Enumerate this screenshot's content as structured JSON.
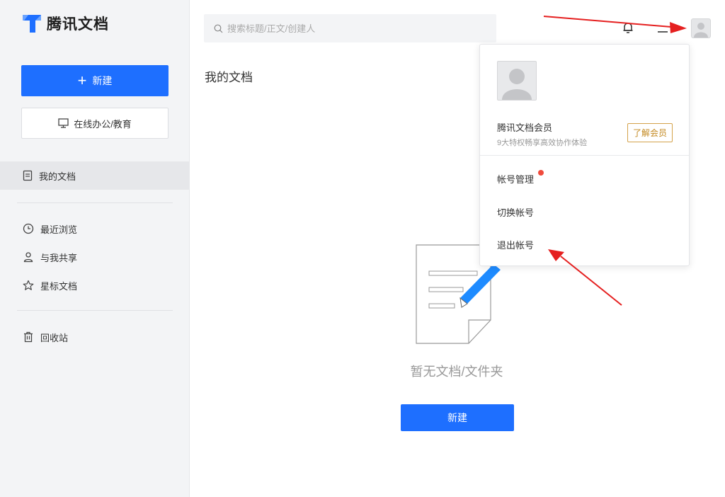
{
  "app": {
    "logo_text": "腾讯文档"
  },
  "sidebar": {
    "new_button": "新建",
    "office_button": "在线办公/教育",
    "items": [
      {
        "label": "我的文档",
        "icon": "document-icon"
      },
      {
        "label": "最近浏览",
        "icon": "clock-icon"
      },
      {
        "label": "与我共享",
        "icon": "person-icon"
      },
      {
        "label": "星标文档",
        "icon": "star-icon"
      },
      {
        "label": "回收站",
        "icon": "trash-icon"
      }
    ]
  },
  "header": {
    "search_placeholder": "搜索标题/正文/创建人"
  },
  "main": {
    "title": "我的文档",
    "empty_text": "暂无文档/文件夹",
    "create_button": "新建"
  },
  "dropdown": {
    "member_title": "腾讯文档会员",
    "member_sub": "9大特权畅享高效协作体验",
    "member_button": "了解会员",
    "items": [
      "帐号管理",
      "切换帐号",
      "退出帐号"
    ]
  },
  "colors": {
    "primary": "#1e6fff",
    "annotation_arrow": "#e52020",
    "member_gold": "#c48a22",
    "notification_dot": "#f04b3c"
  }
}
